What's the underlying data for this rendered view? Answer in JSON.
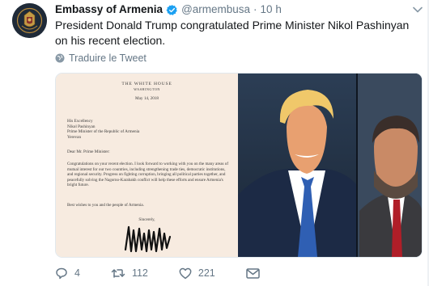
{
  "tweet": {
    "display_name": "Embassy of Armenia",
    "handle": "@armembusa",
    "separator": "·",
    "time": "10 h",
    "text": "President Donald Trump congratulated Prime Minister Nikol Pashinyan on his recent election.",
    "translate_label": "Traduire le Tweet"
  },
  "letter": {
    "heading": "THE WHITE HOUSE",
    "city": "WASHINGTON",
    "date": "May 14, 2018",
    "address": [
      "His Excellency",
      "Nikol Pashinyan",
      "Prime Minister of the Republic of Armenia",
      "Yerevan"
    ],
    "salutation": "Dear Mr. Prime Minister:",
    "body": "Congratulations on your recent election. I look forward to working with you on the many areas of mutual interest for our two countries, including strengthening trade ties, democratic institutions, and regional security. Progress on fighting corruption, bringing all political parties together, and peacefully solving the Nagorno-Karabakh conflict will help these efforts and ensure Armenia's bright future.",
    "closing": "Best wishes to you and the people of Armenia.",
    "signoff": "Sincerely,"
  },
  "actions": {
    "reply_count": "4",
    "retweet_count": "112",
    "like_count": "221"
  },
  "colors": {
    "verified": "#1da1f2",
    "meta_text": "#657786",
    "letter_paper": "#f7ebe0"
  },
  "icons": {
    "avatar": "embassy-emblem-icon",
    "verified": "verified-badge-icon",
    "caret": "chevron-down-icon",
    "translate": "globe-icon",
    "reply": "reply-icon",
    "retweet": "retweet-icon",
    "like": "heart-icon",
    "dm": "envelope-icon"
  }
}
